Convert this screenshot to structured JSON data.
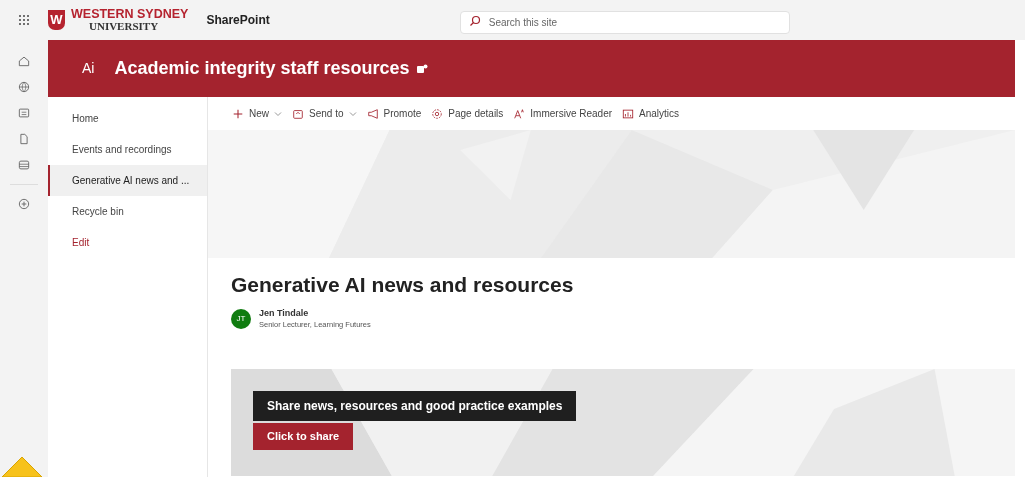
{
  "suite_bar": {
    "logo_mark": "W",
    "logo_line_1": "WESTERN SYDNEY",
    "logo_line_2": "UNIVERSITY",
    "app_name": "SharePoint",
    "search": {
      "placeholder": "Search this site"
    }
  },
  "site_header": {
    "site_logo": "Ai",
    "title": "Academic integrity staff resources"
  },
  "nav": [
    {
      "label": "Home",
      "selected": false,
      "kind": "link"
    },
    {
      "label": "Events and recordings",
      "selected": false,
      "kind": "link"
    },
    {
      "label": "Generative AI news and ...",
      "selected": true,
      "kind": "link"
    },
    {
      "label": "Recycle bin",
      "selected": false,
      "kind": "link"
    },
    {
      "label": "Edit",
      "selected": false,
      "kind": "edit"
    }
  ],
  "toolbar": [
    {
      "label": "New",
      "has_menu": true
    },
    {
      "label": "Send to",
      "has_menu": true
    },
    {
      "label": "Promote",
      "has_menu": false
    },
    {
      "label": "Page details",
      "has_menu": false
    },
    {
      "label": "Immersive Reader",
      "has_menu": false
    },
    {
      "label": "Analytics",
      "has_menu": false
    }
  ],
  "page": {
    "title": "Generative AI news and resources",
    "author": {
      "initials": "JT",
      "name": "Jen Tindale",
      "role": "Senior Lecturer, Learning Futures"
    }
  },
  "banner": {
    "heading": "Share news, resources and good practice examples",
    "button": "Click to share"
  }
}
